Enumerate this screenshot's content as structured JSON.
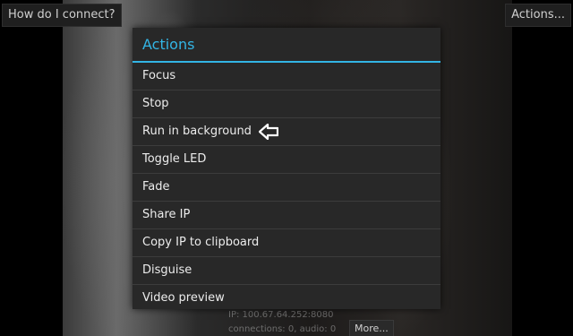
{
  "top_bar": {
    "help_label": "How do I connect?",
    "actions_label": "Actions..."
  },
  "status": {
    "line1": "IP: 100.67.64.252:8080",
    "line2": "connections: 0, audio: 0",
    "more_label": "More..."
  },
  "dialog": {
    "title": "Actions",
    "accent_color": "#33b5e5",
    "items": [
      {
        "label": "Focus"
      },
      {
        "label": "Stop"
      },
      {
        "label": "Run in background"
      },
      {
        "label": "Toggle LED"
      },
      {
        "label": "Fade"
      },
      {
        "label": "Share IP"
      },
      {
        "label": "Copy IP to clipboard"
      },
      {
        "label": "Disguise"
      },
      {
        "label": "Video preview"
      }
    ]
  },
  "icons": {
    "pointer": "left-arrow-icon"
  }
}
